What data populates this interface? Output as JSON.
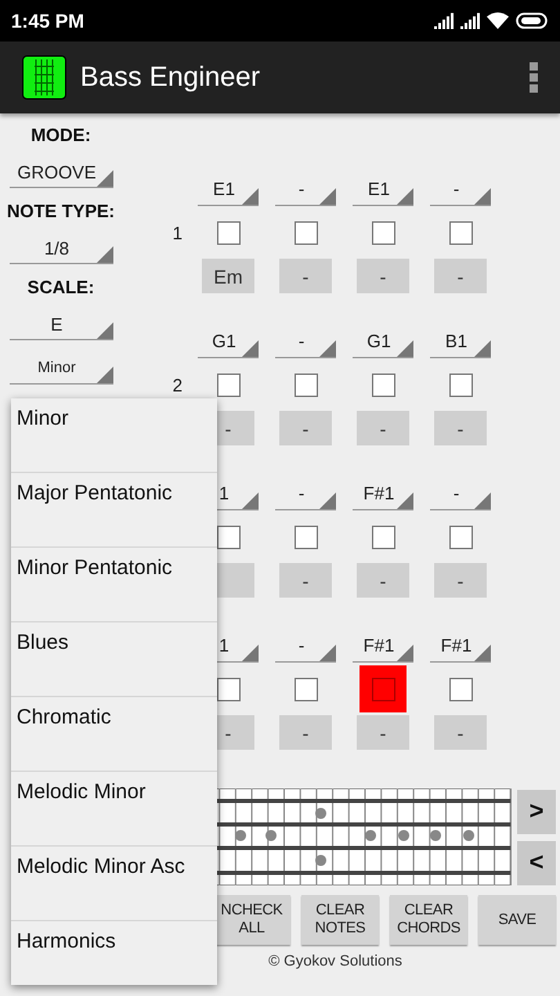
{
  "status_bar": {
    "time": "1:45 PM"
  },
  "app_bar": {
    "title": "Bass Engineer"
  },
  "settings": [
    {
      "label": "MODE:",
      "value": "GROOVE"
    },
    {
      "label": "NOTE TYPE:",
      "value": "1/8"
    },
    {
      "label": "SCALE:",
      "value": "E"
    },
    {
      "value": "Minor"
    }
  ],
  "bars": [
    {
      "number": "1",
      "steps": [
        {
          "note": "E1",
          "checked": false,
          "highlighted": false,
          "chord": "Em"
        },
        {
          "note": "-",
          "checked": false,
          "highlighted": false,
          "chord": "-"
        },
        {
          "note": "E1",
          "checked": false,
          "highlighted": false,
          "chord": "-"
        },
        {
          "note": "-",
          "checked": false,
          "highlighted": false,
          "chord": "-"
        }
      ]
    },
    {
      "number": "2",
      "steps": [
        {
          "note": "G1",
          "checked": false,
          "highlighted": false,
          "chord": "-"
        },
        {
          "note": "-",
          "checked": false,
          "highlighted": false,
          "chord": "-"
        },
        {
          "note": "G1",
          "checked": false,
          "highlighted": false,
          "chord": "-"
        },
        {
          "note": "B1",
          "checked": false,
          "highlighted": false,
          "chord": "-"
        }
      ]
    },
    {
      "steps": [
        {
          "note": "1",
          "checked": false,
          "highlighted": false
        },
        {
          "note": "-",
          "checked": false,
          "highlighted": false,
          "chord": "-"
        },
        {
          "note": "F#1",
          "checked": false,
          "highlighted": false,
          "chord": "-"
        },
        {
          "note": "-",
          "checked": false,
          "highlighted": false,
          "chord": "-"
        }
      ]
    },
    {
      "steps": [
        {
          "note": "1",
          "checked": false,
          "highlighted": false,
          "chord": "-"
        },
        {
          "note": "-",
          "checked": false,
          "highlighted": false,
          "chord": "-"
        },
        {
          "note": "F#1",
          "checked": false,
          "highlighted": true,
          "chord": "-"
        },
        {
          "note": "F#1",
          "checked": false,
          "highlighted": false,
          "chord": "-"
        }
      ]
    }
  ],
  "fret_nav": {
    "next": ">",
    "previous": "<"
  },
  "buttons": [
    "NCHECK ALL",
    "CLEAR NOTES",
    "CLEAR CHORDS",
    "SAVE"
  ],
  "footer": "© Gyokov Solutions",
  "scale_dropdown": {
    "options": [
      {
        "label": "Minor",
        "selected": false
      },
      {
        "label": "Major Pentatonic",
        "selected": false
      },
      {
        "label": "Minor Pentatonic",
        "selected": false
      },
      {
        "label": "Blues",
        "selected": false
      },
      {
        "label": "Chromatic",
        "selected": false
      },
      {
        "label": "Melodic Minor",
        "selected": false
      },
      {
        "label": "Melodic Minor Asc",
        "selected": false
      },
      {
        "label": "Harmonics",
        "selected": false
      }
    ]
  }
}
